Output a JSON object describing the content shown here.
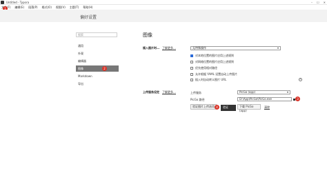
{
  "window": {
    "title": "Untitled - Typora",
    "controls": [
      "–",
      "☐",
      "✕"
    ]
  },
  "menu": [
    "文件(F)",
    "编辑(E)",
    "段落(P)",
    "格式(O)",
    "视图(V)",
    "主题(T)",
    "帮助(H)"
  ],
  "header": {
    "back_label": "偏好设置"
  },
  "sidebar": {
    "search_placeholder": "搜索",
    "items": [
      {
        "label": "通用"
      },
      {
        "label": "外观"
      },
      {
        "label": "编辑器"
      },
      {
        "label": "图像"
      },
      {
        "label": "Markdown"
      },
      {
        "label": "导出"
      }
    ]
  },
  "main": {
    "title": "图像",
    "insert": {
      "label": "插入图片时…",
      "learn_more": "了解更多…",
      "selected": "无特殊操作",
      "options": [
        {
          "label": "对本地位置的图片应用上述规则",
          "checked": true
        },
        {
          "label": "对网络位置的图片应用上述规则",
          "checked": false
        },
        {
          "label": "优先使用相对路径",
          "checked": false
        },
        {
          "label": "允许根据 YAML 设置自动上传图片",
          "checked": false
        },
        {
          "label": "插入时自动转义图片 URL",
          "checked": false
        }
      ],
      "help": "?"
    },
    "upload": {
      "label": "上传服务设定",
      "learn_more": "了解更多…",
      "service_label": "上传服务",
      "service_value": "PicGo (app)",
      "path_label": "PicGo 路径",
      "path_value": "D:\\App\\PicGo\\PicGo.exe",
      "verify_button": "验证图片上传选项",
      "verify_tooltip": "验证",
      "download_button": "下载 PicGo (app)",
      "download_link": "清除"
    }
  },
  "badges": [
    "1",
    "2",
    "3",
    "4"
  ],
  "colors": {
    "badge": "#d9352a",
    "active_item": "#777777",
    "checkbox": "#2b6ad8"
  }
}
